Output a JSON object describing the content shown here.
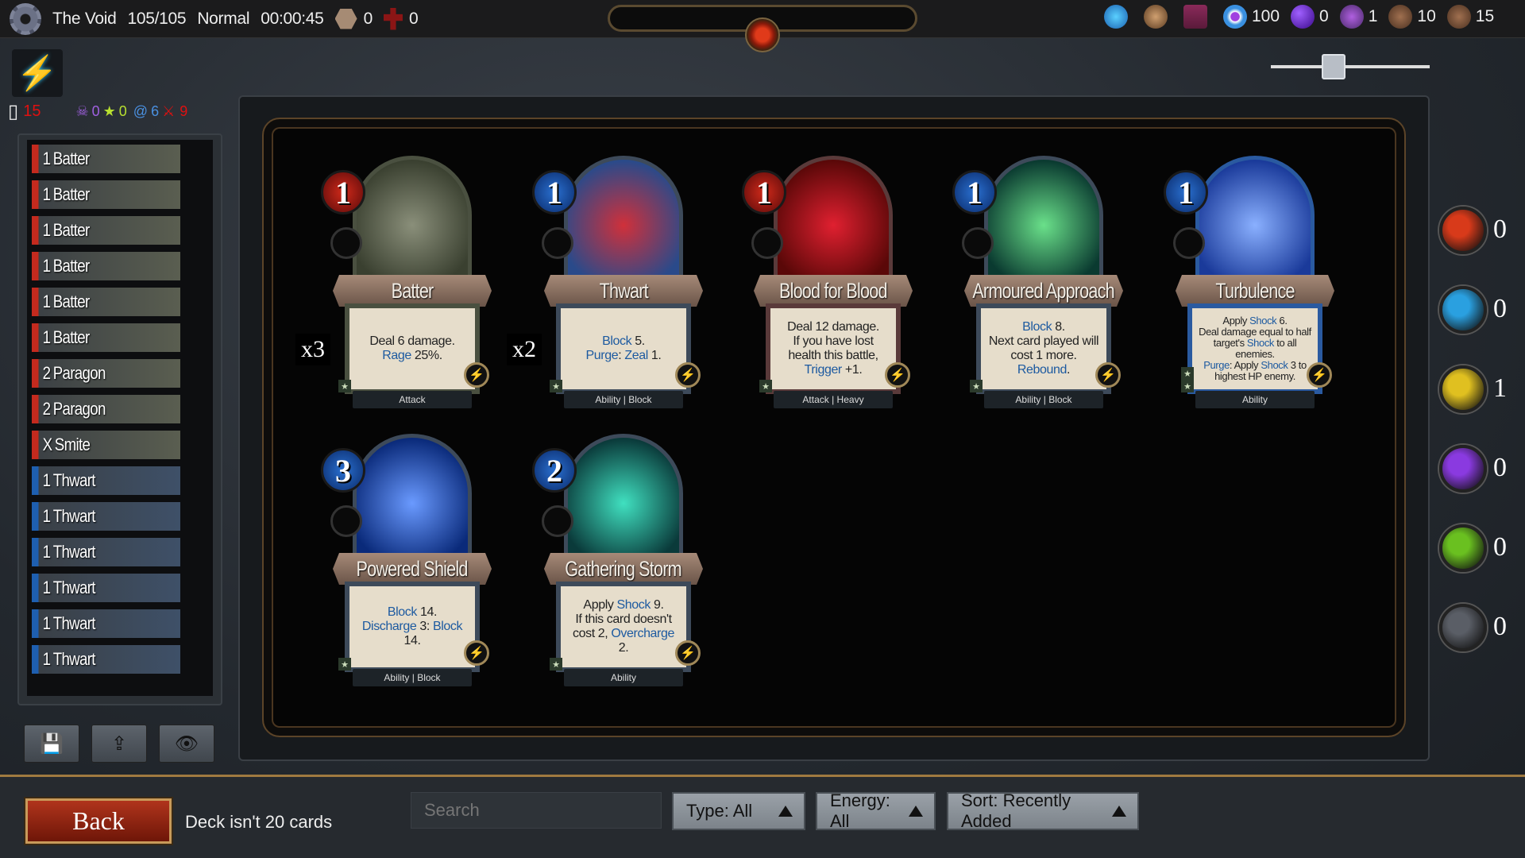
{
  "topbar": {
    "location": "The Void",
    "hp": "105/105",
    "difficulty": "Normal",
    "timer": "00:00:45",
    "hex_count": "0",
    "red_count": "0",
    "resources": [
      {
        "icon": "blue-gem-icon",
        "value": ""
      },
      {
        "icon": "scroll-icon",
        "value": ""
      },
      {
        "icon": "spellbook-icon",
        "value": ""
      },
      {
        "icon": "blue-token-icon",
        "value": "100"
      },
      {
        "icon": "purple-orb-icon",
        "value": "0"
      },
      {
        "icon": "potion-icon",
        "value": "1"
      },
      {
        "icon": "backpack-icon",
        "value": "10"
      },
      {
        "icon": "backpack-large-icon",
        "value": "15"
      }
    ]
  },
  "stats": {
    "deck_size": "15",
    "skull": "0",
    "star": "0",
    "swirl": "6",
    "sword": "9"
  },
  "colors": {
    "red": "#c42a1e",
    "blue": "#1e5fb0",
    "keyword": "#1d5aa0",
    "gold": "#a07a40"
  },
  "deck_list": [
    {
      "cost": "1",
      "name": "Batter",
      "color": "red"
    },
    {
      "cost": "1",
      "name": "Batter",
      "color": "red"
    },
    {
      "cost": "1",
      "name": "Batter",
      "color": "red"
    },
    {
      "cost": "1",
      "name": "Batter",
      "color": "red"
    },
    {
      "cost": "1",
      "name": "Batter",
      "color": "red"
    },
    {
      "cost": "1",
      "name": "Batter",
      "color": "red"
    },
    {
      "cost": "2",
      "name": "Paragon",
      "color": "red"
    },
    {
      "cost": "2",
      "name": "Paragon",
      "color": "red"
    },
    {
      "cost": "X",
      "name": "Smite",
      "color": "red"
    },
    {
      "cost": "1",
      "name": "Thwart",
      "color": "blue"
    },
    {
      "cost": "1",
      "name": "Thwart",
      "color": "blue"
    },
    {
      "cost": "1",
      "name": "Thwart",
      "color": "blue"
    },
    {
      "cost": "1",
      "name": "Thwart",
      "color": "blue"
    },
    {
      "cost": "1",
      "name": "Thwart",
      "color": "blue"
    },
    {
      "cost": "1",
      "name": "Thwart",
      "color": "blue"
    }
  ],
  "deck_buttons": [
    {
      "icon": "save-icon",
      "glyph": "💾"
    },
    {
      "icon": "upload-icon",
      "glyph": "⇪"
    },
    {
      "icon": "eye-icon",
      "glyph": "👁"
    }
  ],
  "cards": [
    {
      "name": "Batter",
      "cost": "1",
      "cost_color": "red",
      "count": "x3",
      "type": "Attack",
      "stars": 1,
      "art": [
        "#8a8f7a",
        "#3a4030"
      ],
      "frame": "#4a5040",
      "desc": [
        [
          [
            "Deal 6 damage.",
            false
          ]
        ],
        [
          [
            "Rage",
            true
          ],
          [
            " 25%.",
            false
          ]
        ]
      ]
    },
    {
      "name": "Thwart",
      "cost": "1",
      "cost_color": "blue",
      "count": "x2",
      "type": "Ability | Block",
      "stars": 1,
      "art": [
        "#d0303a",
        "#2a4a8a"
      ],
      "frame": "#3d4a5a",
      "desc": [
        [
          [
            "Block",
            true
          ],
          [
            " 5.",
            false
          ]
        ],
        [
          [
            "Purge",
            true
          ],
          [
            ": ",
            false
          ],
          [
            "Zeal",
            true
          ],
          [
            " 1.",
            false
          ]
        ]
      ]
    },
    {
      "name": "Blood for Blood",
      "cost": "1",
      "cost_color": "red",
      "count": "",
      "type": "Attack | Heavy",
      "stars": 1,
      "art": [
        "#e02030",
        "#5a0808"
      ],
      "frame": "#5a3a3a",
      "desc": [
        [
          [
            "Deal 12 damage.",
            false
          ]
        ],
        [
          [
            "If you have lost",
            false
          ]
        ],
        [
          [
            "health this battle,",
            false
          ]
        ],
        [
          [
            "Trigger",
            true
          ],
          [
            " +1.",
            false
          ]
        ]
      ]
    },
    {
      "name": "Armoured Approach",
      "cost": "1",
      "cost_color": "blue",
      "count": "",
      "type": "Ability | Block",
      "stars": 1,
      "art": [
        "#6ae08a",
        "#0a3a30"
      ],
      "frame": "#3d4a5a",
      "desc": [
        [
          [
            "Block",
            true
          ],
          [
            " 8.",
            false
          ]
        ],
        [
          [
            "Next card played will",
            false
          ]
        ],
        [
          [
            "cost 1 more.",
            false
          ]
        ],
        [
          [
            "Rebound",
            true
          ],
          [
            ".",
            false
          ]
        ]
      ]
    },
    {
      "name": "Turbulence",
      "cost": "1",
      "cost_color": "blue",
      "count": "",
      "type": "Ability",
      "stars": 2,
      "art": [
        "#8ab0ff",
        "#1a3a9a"
      ],
      "frame": "#2a5aa0",
      "small": true,
      "desc": [
        [
          [
            "Apply ",
            false
          ],
          [
            "Shock",
            true
          ],
          [
            " 6.",
            false
          ]
        ],
        [
          [
            "Deal damage equal to half",
            false
          ]
        ],
        [
          [
            "target's ",
            false
          ],
          [
            "Shock",
            true
          ],
          [
            " to all",
            false
          ]
        ],
        [
          [
            "enemies.",
            false
          ]
        ],
        [
          [
            "Purge",
            true
          ],
          [
            ": Apply ",
            false
          ],
          [
            "Shock",
            true
          ],
          [
            " 3 to",
            false
          ]
        ],
        [
          [
            "highest HP enemy.",
            false
          ]
        ]
      ]
    },
    {
      "name": "Powered Shield",
      "cost": "3",
      "cost_color": "blue",
      "count": "",
      "type": "Ability | Block",
      "stars": 1,
      "art": [
        "#6a9aff",
        "#0a2a7a"
      ],
      "frame": "#3d4a5a",
      "desc": [
        [
          [
            "Block",
            true
          ],
          [
            " 14.",
            false
          ]
        ],
        [
          [
            "Discharge",
            true
          ],
          [
            " 3: ",
            false
          ],
          [
            "Block",
            true
          ]
        ],
        [
          [
            "14.",
            false
          ]
        ]
      ]
    },
    {
      "name": "Gathering Storm",
      "cost": "2",
      "cost_color": "blue",
      "count": "",
      "type": "Ability",
      "stars": 1,
      "art": [
        "#40e0c0",
        "#0a3a3a"
      ],
      "frame": "#3d4a5a",
      "desc": [
        [
          [
            "Apply ",
            false
          ],
          [
            "Shock",
            true
          ],
          [
            " 9.",
            false
          ]
        ],
        [
          [
            "If this card doesn't",
            false
          ]
        ],
        [
          [
            "cost 2, ",
            false
          ],
          [
            "Overcharge",
            true
          ]
        ],
        [
          [
            "2.",
            false
          ]
        ]
      ]
    }
  ],
  "energies": [
    {
      "icon": "fist-energy-icon",
      "color": "#d83a1a",
      "value": "0"
    },
    {
      "icon": "blue-gem-energy-icon",
      "color": "#2aa0e0",
      "value": "0"
    },
    {
      "icon": "shield-energy-icon",
      "color": "#e0c020",
      "value": "1"
    },
    {
      "icon": "lightning-energy-icon",
      "color": "#8a3ae0",
      "value": "0"
    },
    {
      "icon": "leaf-energy-icon",
      "color": "#6ac020",
      "value": "0"
    },
    {
      "icon": "skull-energy-icon",
      "color": "#5a5e66",
      "value": "0"
    }
  ],
  "bottom": {
    "back_label": "Back",
    "deck_message": "Deck isn't 20 cards",
    "search_placeholder": "Search",
    "type_filter": "Type: All",
    "energy_filter": "Energy: All",
    "sort": "Sort: Recently Added"
  }
}
